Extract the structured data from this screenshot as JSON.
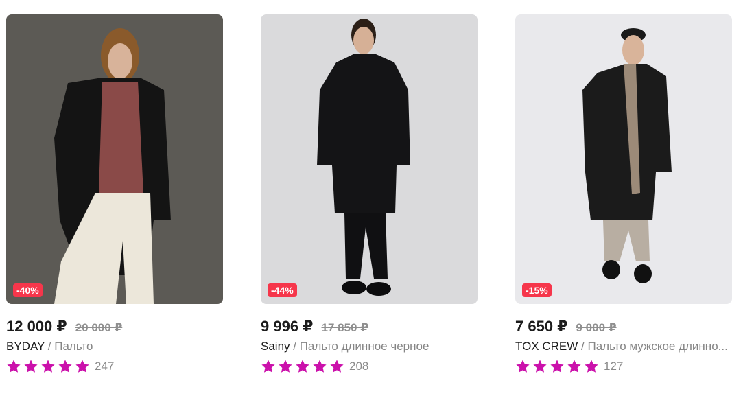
{
  "products": [
    {
      "discount": "-40%",
      "price": "12 000 ₽",
      "old_price": "20 000 ₽",
      "brand": "BYDAY",
      "separator": " / ",
      "name": "Пальто",
      "rating": 5,
      "reviews": "247",
      "photo_bg": "#5c5a55"
    },
    {
      "discount": "-44%",
      "price": "9 996 ₽",
      "old_price": "17 850 ₽",
      "brand": "Sainy",
      "separator": " / ",
      "name": "Пальто длинное черное",
      "rating": 5,
      "reviews": "208",
      "photo_bg": "#dadadc"
    },
    {
      "discount": "-15%",
      "price": "7 650 ₽",
      "old_price": "9 000 ₽",
      "brand": "TOX CREW",
      "separator": " / ",
      "name": "Пальто мужское длинно...",
      "rating": 5,
      "reviews": "127",
      "photo_bg": "#e9e9ec"
    }
  ],
  "colors": {
    "star": "#cb11ab",
    "discount_badge": "#f6364b"
  }
}
